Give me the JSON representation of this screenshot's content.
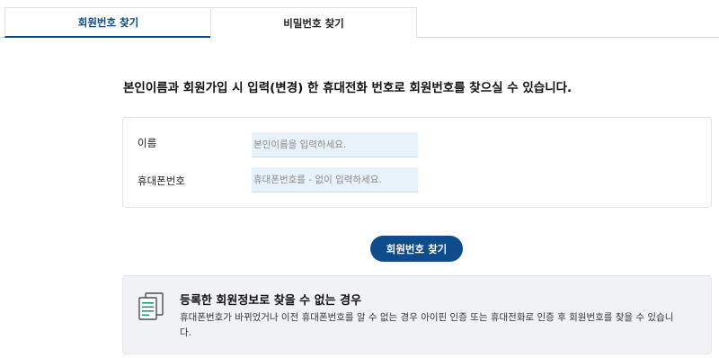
{
  "tabs": [
    {
      "label": "회원번호 찾기",
      "active": true
    },
    {
      "label": "비밀번호 찾기",
      "active": false
    }
  ],
  "headline": "본인이름과 회원가입 시 입력(변경) 한 휴대전화 번호로 회원번호를 찾으실 수 있습니다.",
  "form": {
    "name_label": "이름",
    "name_placeholder": "본인이름을 입력하세요.",
    "phone_label": "휴대폰번호",
    "phone_placeholder": "휴대폰번호를 - 없이 입력하세요."
  },
  "find_button_label": "회원번호 찾기",
  "notice": {
    "icon": "document-icon",
    "title": "등록한 회원정보로 찾을 수 없는 경우",
    "text": "휴대폰번호가 바뀌었거나 이전 휴대폰번호를 알 수 없는 경우 아이핀 인증 또는 휴대전화로 인증 후 회원번호를 찾을 수 있습니다."
  },
  "colors": {
    "accent": "#0f4c8c",
    "input_bg": "#e8f2fb",
    "notice_bg": "#f1f2f5"
  }
}
